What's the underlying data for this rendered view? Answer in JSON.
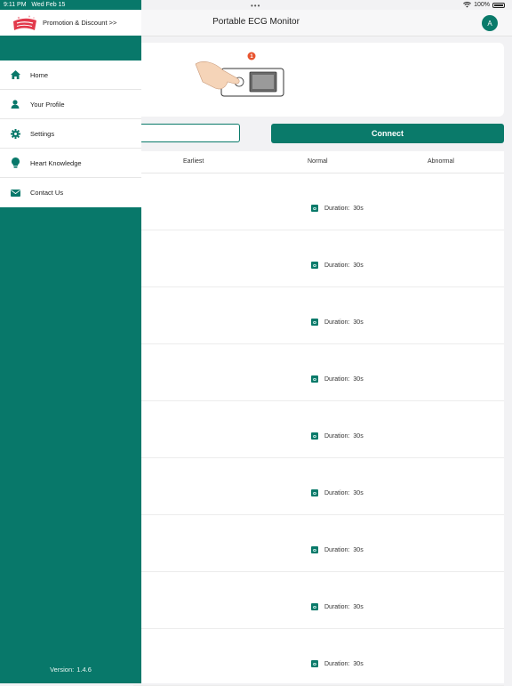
{
  "status_bar": {
    "time": "9:11 PM",
    "date": "Wed Feb 15",
    "battery": "100%"
  },
  "nav": {
    "title": "Portable ECG Monitor",
    "avatar_initial": "A"
  },
  "device": {
    "step_badge": "1"
  },
  "actions": {
    "connect_label": "Connect"
  },
  "table": {
    "headers": [
      "Earliest",
      "Normal",
      "Abnormal"
    ],
    "rows": [
      {
        "duration_label": "Duration:",
        "duration_value": "30s"
      },
      {
        "duration_label": "Duration:",
        "duration_value": "30s"
      },
      {
        "duration_label": "Duration:",
        "duration_value": "30s"
      },
      {
        "duration_label": "Duration:",
        "duration_value": "30s"
      },
      {
        "duration_label": "Duration:",
        "duration_value": "30s"
      },
      {
        "duration_label": "Duration:",
        "duration_value": "30s"
      },
      {
        "duration_label": "Duration:",
        "duration_value": "30s"
      },
      {
        "duration_label": "Duration:",
        "duration_value": "30s"
      },
      {
        "duration_label": "Duration:",
        "duration_value": "30s"
      }
    ]
  },
  "drawer": {
    "promo_label": "Promotion & Discount  >>",
    "menu": [
      {
        "label": "Home",
        "icon": "home-icon"
      },
      {
        "label": "Your Profile",
        "icon": "user-icon"
      },
      {
        "label": "Settings",
        "icon": "gear-icon"
      },
      {
        "label": "Heart Knowledge",
        "icon": "lightbulb-icon"
      },
      {
        "label": "Contact Us",
        "icon": "envelope-icon"
      }
    ],
    "version_label": "Version:",
    "version_value": "1.4.6"
  },
  "colors": {
    "brand": "#08786a",
    "badge": "#e8542f"
  }
}
